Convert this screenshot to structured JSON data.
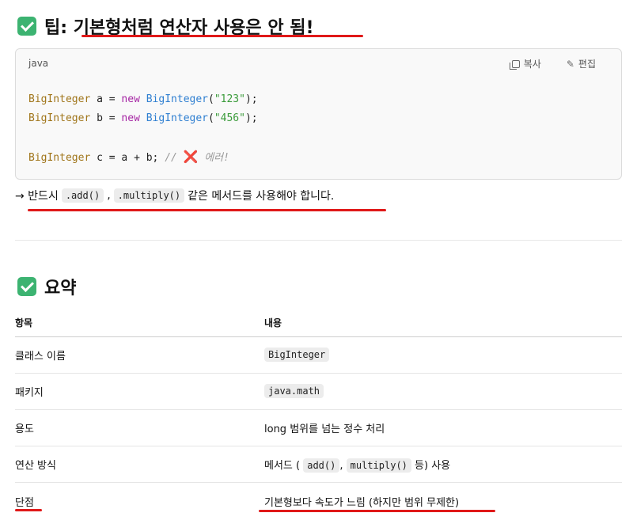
{
  "tip": {
    "icon": "check-mark-icon",
    "title": "팁: 기본형처럼 연산자 사용은 안 됨!"
  },
  "code_block": {
    "language": "java",
    "copy_label": "복사",
    "edit_label": "편집",
    "lines": [
      {
        "type": "BigInteger",
        "var": " a = ",
        "kw": "new",
        "cls": " BigInteger",
        "open": "(",
        "str": "\"123\"",
        "close": ");"
      },
      {
        "type": "BigInteger",
        "var": " b = ",
        "kw": "new",
        "cls": " BigInteger",
        "open": "(",
        "str": "\"456\"",
        "close": ");"
      },
      {
        "type": "BigInteger",
        "rest": " c = a + b; ",
        "comment": "// ",
        "error_icon": "❌",
        "error_text": " 에러!"
      }
    ]
  },
  "note": {
    "prefix": "→ 반드시",
    "code1": ".add()",
    "sep": ",",
    "code2": ".multiply()",
    "suffix": "같은 메서드를 사용해야 합니다."
  },
  "summary": {
    "icon": "check-mark-icon",
    "title": "요약",
    "headers": [
      "항목",
      "내용"
    ],
    "rows": [
      {
        "item": "클래스 이름",
        "content_code": "BigInteger"
      },
      {
        "item": "패키지",
        "content_code": "java.math"
      },
      {
        "item": "용도",
        "content_text": "long 범위를 넘는 정수 처리"
      },
      {
        "item": "연산 방식",
        "content_pre": "메서드 (",
        "code_a": "add()",
        "comma": ",",
        "code_b": "multiply()",
        "content_post": "등) 사용"
      },
      {
        "item": "단점",
        "content_text": "기본형보다 속도가 느림 (하지만 범위 무제한)"
      }
    ]
  },
  "colors": {
    "annotation_underline": "#e01919",
    "check_icon": "#3cb371"
  }
}
